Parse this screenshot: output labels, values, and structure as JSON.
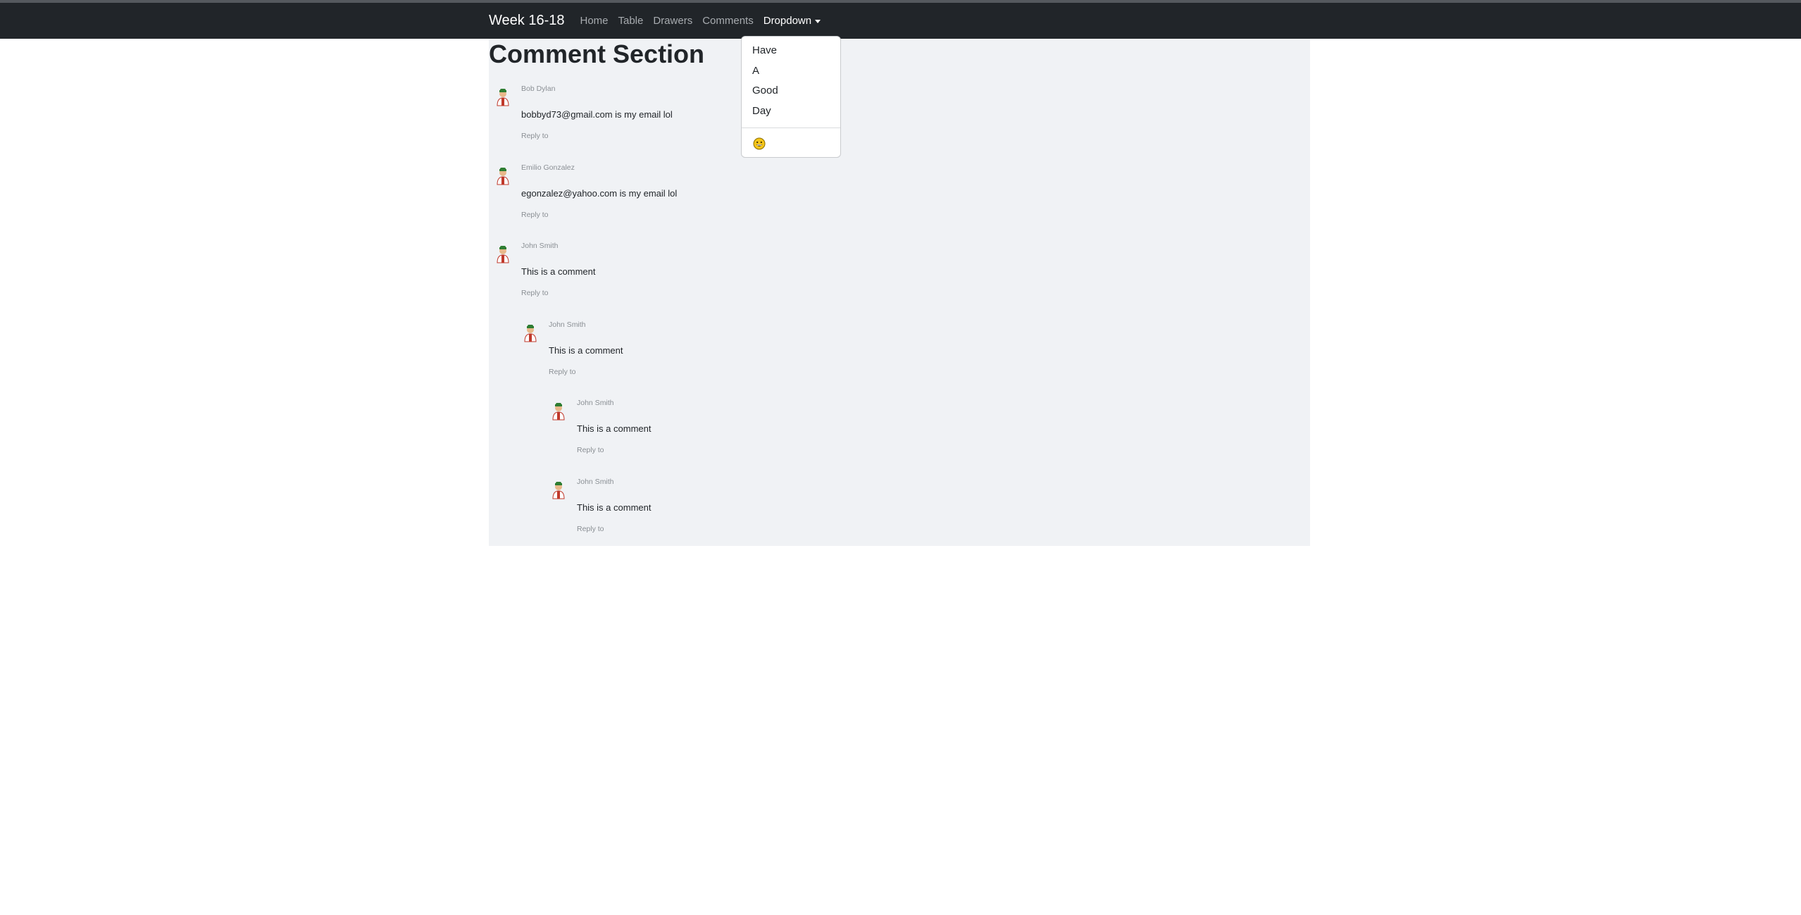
{
  "navbar": {
    "brand": "Week 16-18",
    "links": [
      "Home",
      "Table",
      "Drawers",
      "Comments"
    ],
    "dropdown_label": "Dropdown"
  },
  "dropdown": {
    "items": [
      "Have",
      "A",
      "Good",
      "Day"
    ],
    "emoji_icon": "grinning-face-icon"
  },
  "page": {
    "title": "Comment Section"
  },
  "comments": [
    {
      "name": "Bob Dylan",
      "text": "bobbyd73@gmail.com is my email lol",
      "reply": "Reply to",
      "depth": 0
    },
    {
      "name": "Emilio Gonzalez",
      "text": "egonzalez@yahoo.com is my email lol",
      "reply": "Reply to",
      "depth": 0
    },
    {
      "name": "John Smith",
      "text": "This is a comment",
      "reply": "Reply to",
      "depth": 0
    },
    {
      "name": "John Smith",
      "text": "This is a comment",
      "reply": "Reply to",
      "depth": 1
    },
    {
      "name": "John Smith",
      "text": "This is a comment",
      "reply": "Reply to",
      "depth": 2
    },
    {
      "name": "John Smith",
      "text": "This is a comment",
      "reply": "Reply to",
      "depth": 2
    }
  ],
  "colors": {
    "navbar_bg": "#212529",
    "content_bg": "#f0f2f5",
    "muted_text": "#8a8f94"
  }
}
